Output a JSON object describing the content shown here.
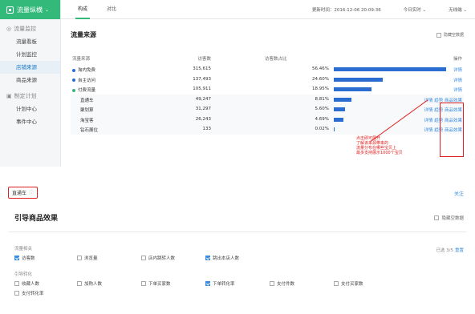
{
  "sidebar": {
    "brand": "流量纵横",
    "sections": [
      {
        "label": "流量监控",
        "items": [
          {
            "label": "流量看板",
            "active": false
          },
          {
            "label": "计划监控",
            "active": false
          },
          {
            "label": "店铺来源",
            "active": true
          },
          {
            "label": "商品来源",
            "active": false
          }
        ]
      },
      {
        "label": "制定计划",
        "items": [
          {
            "label": "计划中心",
            "active": false
          },
          {
            "label": "事件中心",
            "active": false
          }
        ]
      }
    ]
  },
  "topbar": {
    "tabs": [
      "构成",
      "对比"
    ],
    "update_time": "更新时间：2016-12-06 20:09:36",
    "period": "今日实时",
    "device": "无线端"
  },
  "panel": {
    "title": "流量来源",
    "hide_empty": "隐藏空数据",
    "headers": {
      "name": "流量来源",
      "visits": "访客数",
      "pct": "访客数占比",
      "ops": "操作"
    },
    "rows": [
      {
        "name": "淘内免费",
        "visits": "315,615",
        "pct": "56.46%",
        "ratio": 0.5646,
        "ops": "详情",
        "dot": "#2b6cd0",
        "sub": false
      },
      {
        "name": "自主访问",
        "visits": "137,493",
        "pct": "24.60%",
        "ratio": 0.246,
        "ops": "详情",
        "dot": "#2b6cd0",
        "sub": false
      },
      {
        "name": "付费流量",
        "visits": "105,911",
        "pct": "18.95%",
        "ratio": 0.1895,
        "ops": "详情",
        "dot": "#33b97a",
        "sub": false
      },
      {
        "name": "直通车",
        "visits": "49,247",
        "pct": "8.81%",
        "ratio": 0.0881,
        "ops": "详情 趋势 商品效果",
        "sub": true
      },
      {
        "name": "聚划算",
        "visits": "31,297",
        "pct": "5.60%",
        "ratio": 0.056,
        "ops": "详情 趋势 商品效果",
        "sub": true
      },
      {
        "name": "淘宝客",
        "visits": "26,243",
        "pct": "4.69%",
        "ratio": 0.0469,
        "ops": "详情 趋势 商品效果",
        "sub": true
      },
      {
        "name": "钻石展位",
        "visits": "133",
        "pct": "0.02%",
        "ratio": 0.0002,
        "ops": "详情 趋势 商品效果",
        "sub": true
      }
    ],
    "annotation": [
      "点击即可展开",
      "了解该来源带来的",
      "流量分布在哪些宝贝上",
      "最多支持展示1000个宝贝"
    ]
  },
  "lower": {
    "crumb": "直通车",
    "crumb_q": "ⓘ",
    "follow": "关注",
    "title": "引导商品效果",
    "hide_empty": "隐藏空数据",
    "selected": "已选 3/5",
    "reset": "重置",
    "groups": [
      {
        "label": "流量相关",
        "options": [
          {
            "label": "访客数",
            "checked": true
          },
          {
            "label": "浏览量",
            "checked": false
          },
          {
            "label": "店内跳转人数",
            "checked": false
          },
          {
            "label": "跳出本店人数",
            "checked": true
          }
        ]
      },
      {
        "label": "引导转化",
        "options": [
          {
            "label": "收藏人数",
            "checked": false
          },
          {
            "label": "加购人数",
            "checked": false
          },
          {
            "label": "下单买家数",
            "checked": false
          },
          {
            "label": "下单转化率",
            "checked": true
          },
          {
            "label": "支付件数",
            "checked": false
          },
          {
            "label": "支付买家数",
            "checked": false
          },
          {
            "label": "支付转化率",
            "checked": false
          }
        ]
      }
    ]
  },
  "colors": {
    "brand": "#33b97a",
    "bar": "#2b6cd0",
    "link": "#3d8ee0",
    "annotation": "#e02020"
  }
}
